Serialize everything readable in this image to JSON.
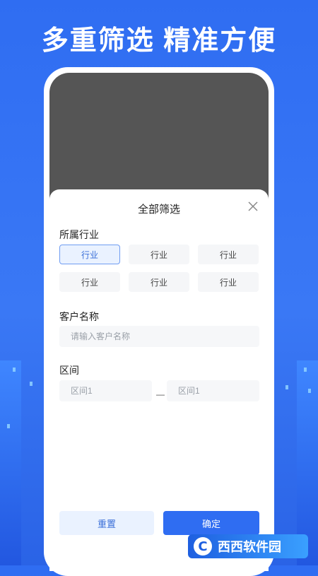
{
  "banner": {
    "headline": "多重筛选 精准方便"
  },
  "sheet": {
    "title": "全部筛选",
    "industry": {
      "label": "所属行业",
      "options": [
        "行业",
        "行业",
        "行业",
        "行业",
        "行业",
        "行业"
      ],
      "selected_index": 0
    },
    "customer": {
      "label": "客户名称",
      "placeholder": "请输入客户名称"
    },
    "range": {
      "label": "区间",
      "from_placeholder": "区间1",
      "separator": "—",
      "to_placeholder": "区间1"
    },
    "buttons": {
      "reset": "重置",
      "confirm": "确定"
    }
  },
  "watermark": {
    "text": "西西软件园"
  },
  "colors": {
    "brand_blue": "#2f6df2",
    "selected_chip_border": "#6f9cf2"
  }
}
